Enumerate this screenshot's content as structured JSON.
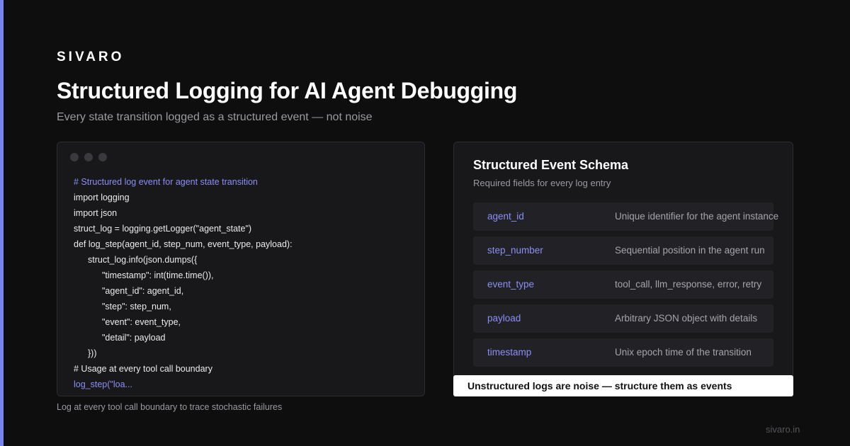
{
  "brand": "SIVARO",
  "title": "Structured Logging for AI Agent Debugging",
  "subtitle": "Every state transition logged as a structured event — not noise",
  "code": {
    "lines": [
      "# Structured log event for agent state transition",
      "import logging",
      "import json",
      "struct_log = logging.getLogger(\"agent_state\")",
      "def log_step(agent_id, step_num, event_type, payload):",
      "struct_log.info(json.dumps({",
      "\"timestamp\": int(time.time()),",
      "\"agent_id\": agent_id,",
      "\"step\": step_num,",
      "\"event\": event_type,",
      "\"detail\": payload",
      "}))",
      "# Usage at every tool call boundary",
      "log_step(\"loa..."
    ],
    "caption": "Log at every tool call boundary to trace stochastic failures"
  },
  "schema": {
    "title": "Structured Event Schema",
    "subtitle": "Required fields for every log entry",
    "fields": [
      {
        "name": "agent_id",
        "description": "Unique identifier for the agent instance"
      },
      {
        "name": "step_number",
        "description": "Sequential position in the agent run"
      },
      {
        "name": "event_type",
        "description": "tool_call, llm_response, error, retry"
      },
      {
        "name": "payload",
        "description": "Arbitrary JSON object with details"
      },
      {
        "name": "timestamp",
        "description": "Unix epoch time of the transition"
      }
    ]
  },
  "callout": "Unstructured logs are noise — structure them as events",
  "footer_url": "sivaro.in",
  "colors": {
    "accent": "#7b83f0",
    "background": "#0e0e0f",
    "panel": "#18181b",
    "field_name": "#8a8ff5"
  }
}
